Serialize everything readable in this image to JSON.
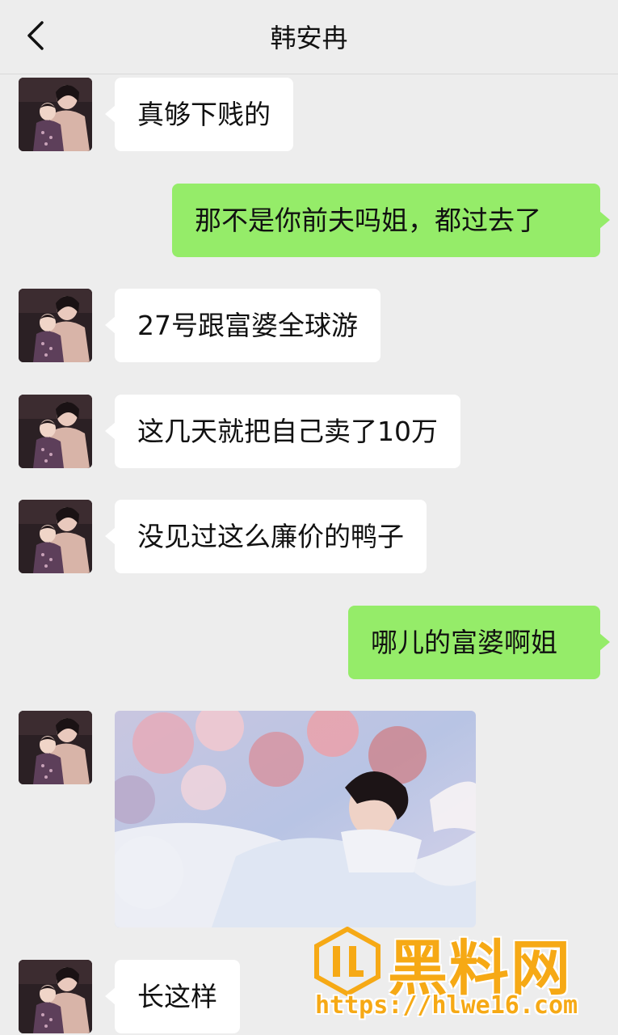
{
  "header": {
    "title": "韩安冉"
  },
  "messages": [
    {
      "side": "left",
      "text": "真够下贱的"
    },
    {
      "side": "right",
      "text": "那不是你前夫吗姐，都过去了"
    },
    {
      "side": "left",
      "text": "27号跟富婆全球游"
    },
    {
      "side": "left",
      "text": "这几天就把自己卖了10万"
    },
    {
      "side": "left",
      "text": "没见过这么廉价的鸭子"
    },
    {
      "side": "right",
      "text": "哪儿的富婆啊姐"
    },
    {
      "side": "left",
      "type": "image"
    },
    {
      "side": "left",
      "text": "长这样"
    }
  ],
  "watermark": {
    "brand": "黑料网",
    "url": "https://hlwe16.com"
  },
  "colors": {
    "background": "#ededed",
    "sent_bubble": "#95ec69",
    "received_bubble": "#ffffff",
    "watermark": "#f6a915"
  },
  "icons": {
    "back": "chevron-left-icon"
  }
}
